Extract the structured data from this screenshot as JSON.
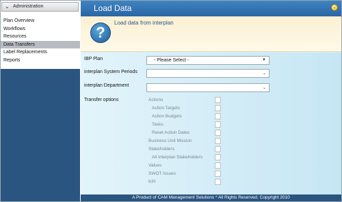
{
  "sidebar": {
    "header": "Administration",
    "items": [
      {
        "label": "Plan Overview"
      },
      {
        "label": "Workflows"
      },
      {
        "label": "Resources"
      },
      {
        "label": "Data Transfers"
      },
      {
        "label": "Label Replacements"
      },
      {
        "label": "Reports"
      }
    ]
  },
  "header": {
    "title": "Load Data"
  },
  "banner": {
    "subtitle": "Load data from interplan",
    "icon_glyph": "?"
  },
  "form": {
    "ibp_plan_label": "IBP Plan",
    "ibp_plan_value": "- Please Select -",
    "system_periods_label": "interplan System Periods",
    "department_label": "interplan Department",
    "transfer_options_label": "Transfer options",
    "options": [
      "Actions",
      "Action Targets",
      "Action Budgets",
      "Tasks",
      "Reset Action Dates",
      "Business Unit Mission",
      "Stakeholders",
      "All Interplan Stakeholders",
      "Values",
      "SWOT Issues",
      "KPI"
    ]
  },
  "footer": {
    "text": "A Product of CAM Management Solutions  * All Rights Reserved. Copyright 2010"
  },
  "colors": {
    "accent": "#2a65a4",
    "sidebar_bg": "#2a5580",
    "form_bg": "#d7f0fa"
  }
}
